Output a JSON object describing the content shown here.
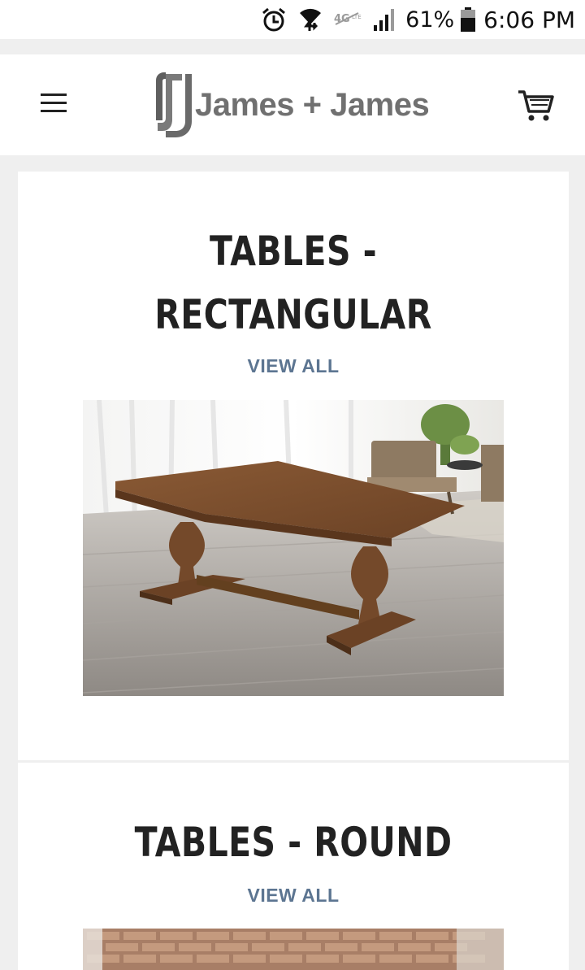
{
  "status_bar": {
    "icons": [
      "alarm-icon",
      "wifi-icon",
      "lte-icon",
      "signal-icon",
      "battery-icon"
    ],
    "battery_percent": "61%",
    "time": "6:06 PM"
  },
  "header": {
    "brand": "James + James",
    "menu_icon": "hamburger-menu-icon",
    "cart_icon": "shopping-cart-icon"
  },
  "collections": [
    {
      "title_line1": "TABLES -",
      "title_line2": "RECTANGULAR",
      "view_all": "VIEW ALL",
      "image": "rectangular-trestle-table-photo"
    },
    {
      "title": "TABLES - ROUND",
      "view_all": "VIEW ALL",
      "image": "round-table-brick-wall-photo"
    }
  ],
  "colors": {
    "link": "#5c7591",
    "heading": "#222222",
    "logo_gray": "#707070",
    "page_bg": "#efefef"
  }
}
